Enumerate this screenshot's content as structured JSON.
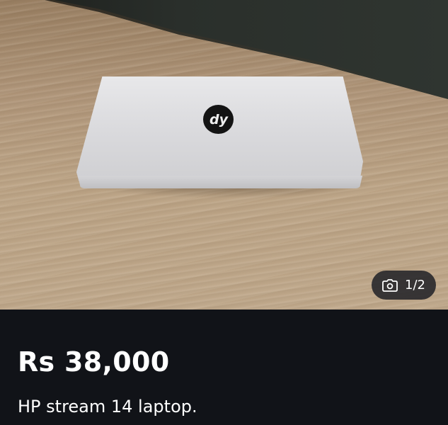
{
  "listing": {
    "price": "Rs 38,000",
    "title": "HP stream 14 laptop.",
    "photo_counter": "1/2",
    "photo_counter_icon": "camera-icon",
    "logo_icon": "hp-logo-icon",
    "colors": {
      "info_background": "#111318",
      "text": "#ffffff",
      "counter_pill": "#1e2026"
    }
  }
}
